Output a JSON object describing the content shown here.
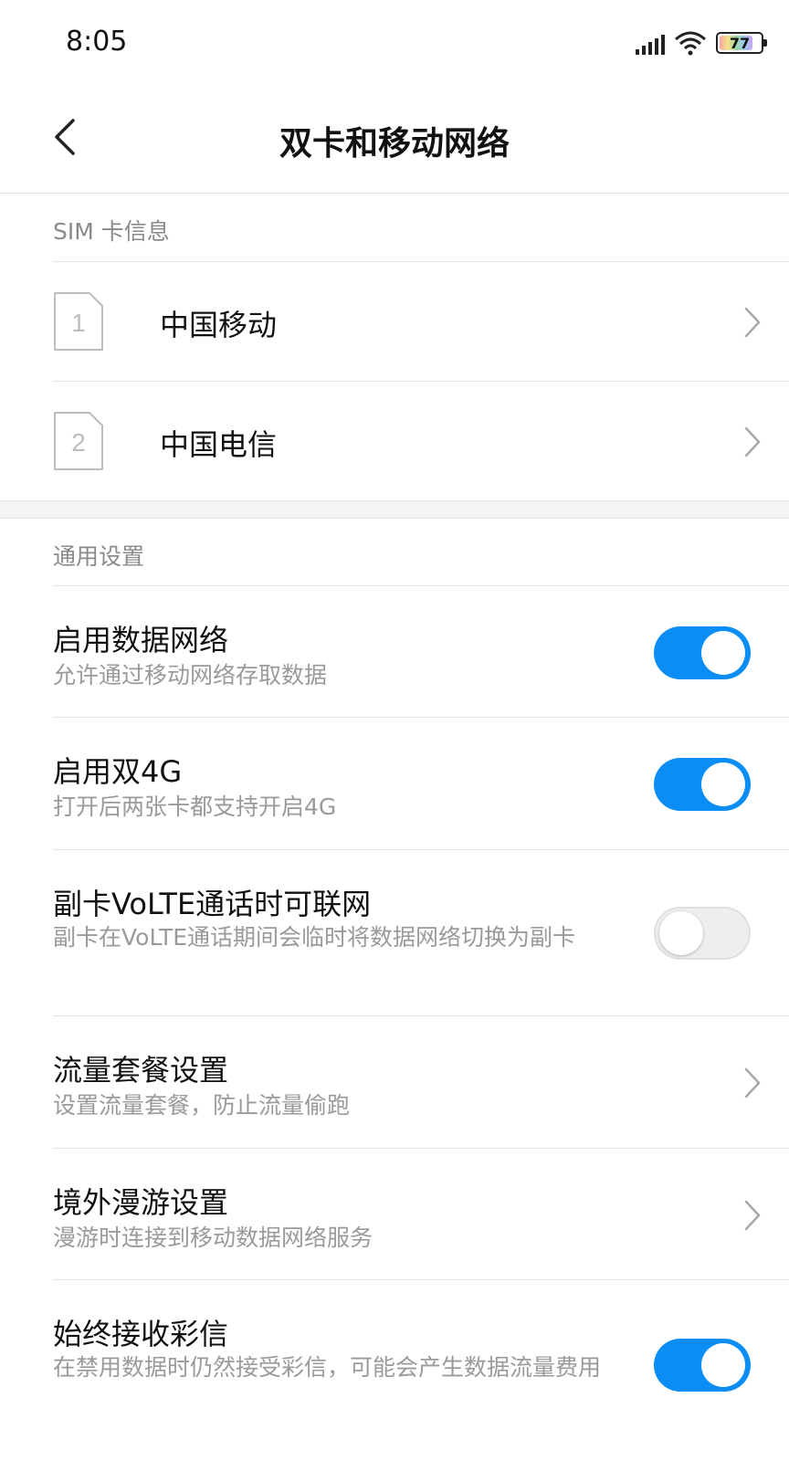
{
  "status_bar": {
    "time": "8:05",
    "battery": "77"
  },
  "header": {
    "title": "双卡和移动网络"
  },
  "sim_section": {
    "label": "SIM 卡信息",
    "cards": [
      {
        "slot": "1",
        "name": "中国移动"
      },
      {
        "slot": "2",
        "name": "中国电信"
      }
    ]
  },
  "general_section": {
    "label": "通用设置",
    "items": [
      {
        "title": "启用数据网络",
        "desc": "允许通过移动网络存取数据",
        "control": "toggle",
        "on": true
      },
      {
        "title": "启用双4G",
        "desc": "打开后两张卡都支持开启4G",
        "control": "toggle",
        "on": true
      },
      {
        "title": "副卡VoLTE通话时可联网",
        "desc": "副卡在VoLTE通话期间会临时将数据网络切换为副卡",
        "control": "toggle",
        "on": false
      },
      {
        "title": "流量套餐设置",
        "desc": "设置流量套餐，防止流量偷跑",
        "control": "chevron"
      },
      {
        "title": "境外漫游设置",
        "desc": "漫游时连接到移动数据网络服务",
        "control": "chevron"
      },
      {
        "title": "始终接收彩信",
        "desc": "在禁用数据时仍然接受彩信，可能会产生数据流量费用",
        "control": "toggle",
        "on": true
      }
    ]
  },
  "colors": {
    "accent": "#0a8ef5",
    "muted_text": "#9a9a9a",
    "section_band": "#f4f4f4"
  }
}
